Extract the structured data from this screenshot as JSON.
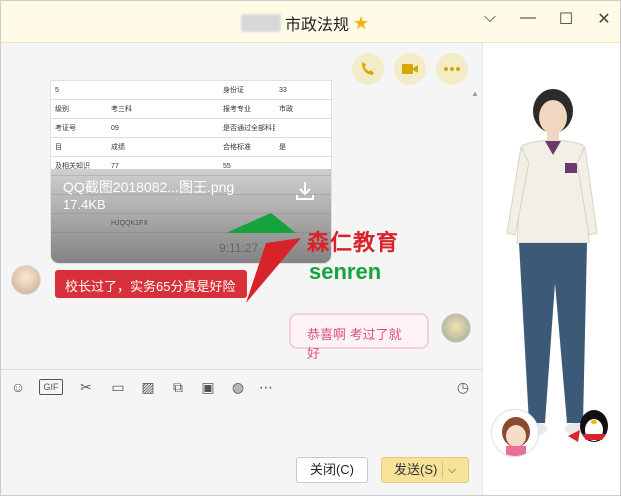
{
  "window": {
    "title": "市政法规",
    "controls": {
      "dropdown": "⌵",
      "minimize": "—",
      "maximize": "☐",
      "close": "✕"
    }
  },
  "actions": {
    "call_icon": "phone-icon",
    "video_icon": "video-icon",
    "more_icon": "more-icon"
  },
  "file_card": {
    "table_rows": [
      [
        "5",
        "",
        "",
        "身份证",
        "33"
      ],
      [
        "级别",
        "考三科",
        "",
        "报考专业",
        "市政"
      ],
      [
        "考证号",
        "09",
        "",
        "是否通过全部科目",
        ""
      ],
      [
        "目",
        "成绩",
        "",
        "合格标准",
        "是"
      ],
      [
        "及相关知识",
        "77",
        "",
        "55",
        ""
      ],
      [
        "",
        "",
        "",
        "",
        ""
      ],
      [
        "",
        "",
        "",
        "",
        ""
      ],
      [
        "",
        "HJQQK1FX",
        "",
        "",
        ""
      ]
    ],
    "file_name": "QQ截图2018082...图王.png",
    "file_size": "17.4KB"
  },
  "timestamp": "9:11:27",
  "watermark": {
    "cn": "森仁教育",
    "en": "senren"
  },
  "messages": [
    {
      "from": "other",
      "text": "校长过了，实务65分真是好险"
    },
    {
      "from": "self",
      "text": "恭喜啊  考过了就好"
    }
  ],
  "toolbar": {
    "emoji": "☺",
    "gif": "GIF",
    "scissors": "✂",
    "folder": "▭",
    "image": "▨",
    "shake": "⧉",
    "redpacket": "▣",
    "music": "◍",
    "more": "⋯",
    "history": "◷"
  },
  "buttons": {
    "close": "关闭(C)",
    "send": "发送(S)",
    "send_arrow": "⌵"
  }
}
